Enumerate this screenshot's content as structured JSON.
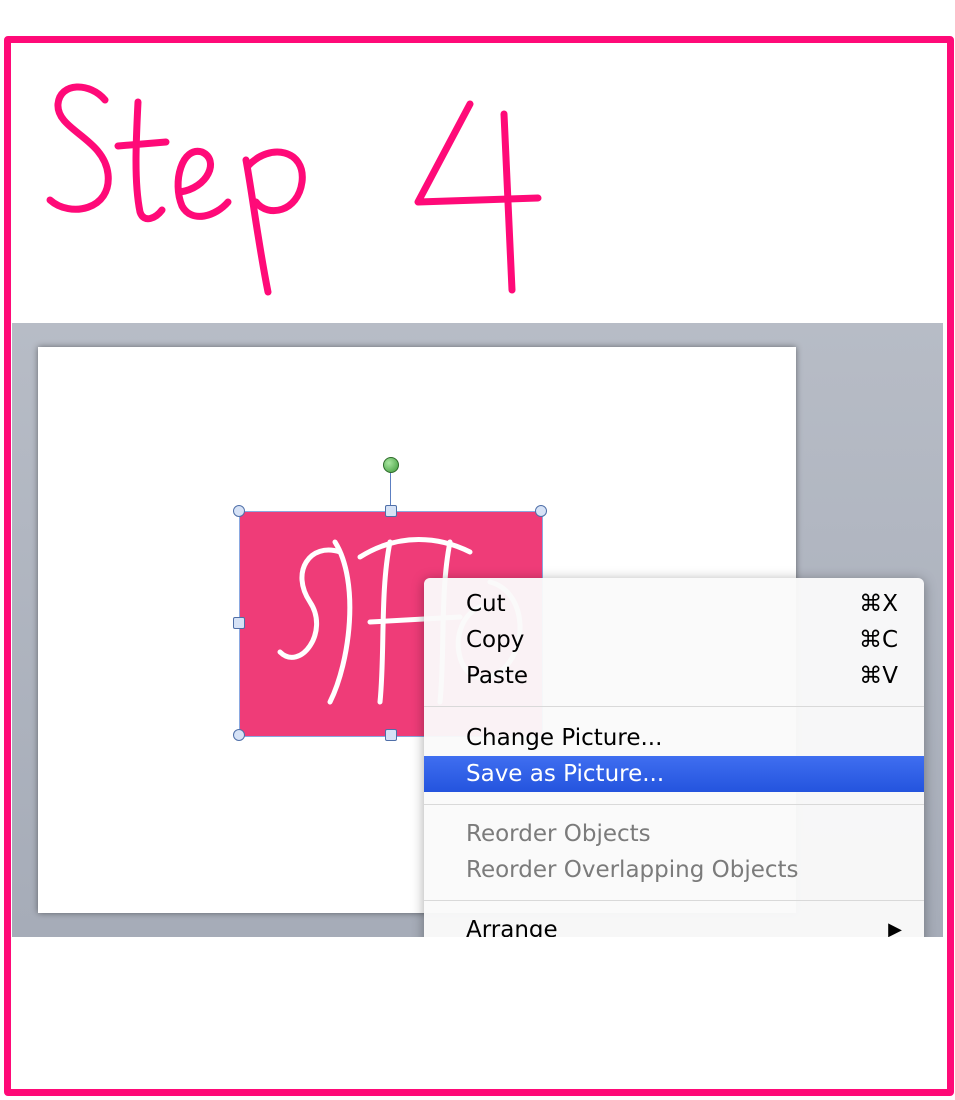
{
  "title": "Step 4",
  "colors": {
    "frame": "#ff0a78",
    "picture_fill": "#ef3c78",
    "highlight": "#2f5fe8",
    "workspace": "#a9afba"
  },
  "picture": {
    "monogram_text": "SHO",
    "icon": "monogram-picture"
  },
  "menu": {
    "items": [
      {
        "label": "Cut",
        "shortcut": "⌘X"
      },
      {
        "label": "Copy",
        "shortcut": "⌘C"
      },
      {
        "label": "Paste",
        "shortcut": "⌘V"
      },
      {
        "label": "Change Picture..."
      },
      {
        "label": "Save as Picture..."
      },
      {
        "label": "Reorder Objects"
      },
      {
        "label": "Reorder Overlapping Objects"
      },
      {
        "label": "Arrange",
        "submenu_icon": "▶"
      }
    ]
  }
}
